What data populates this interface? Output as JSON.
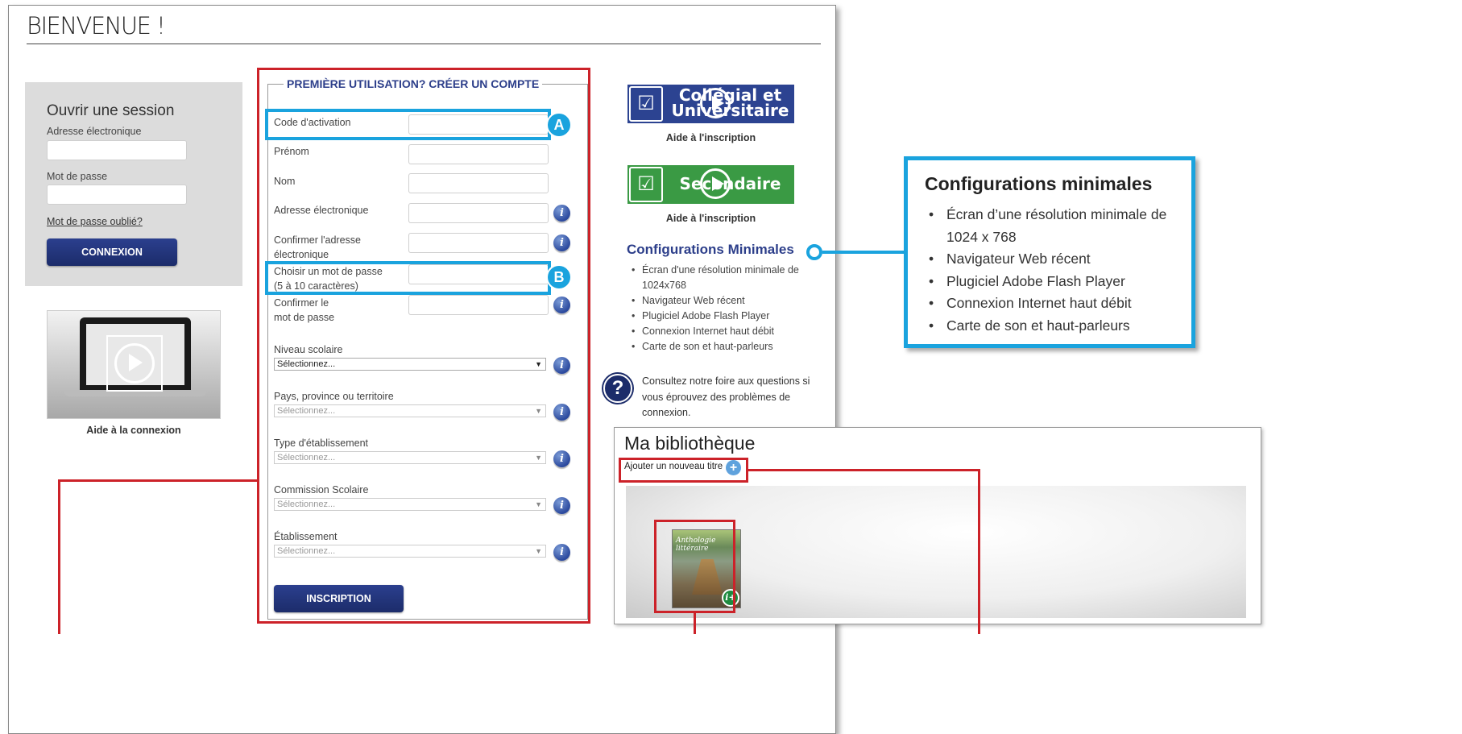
{
  "page": {
    "title": "BIENVENUE !"
  },
  "login": {
    "title": "Ouvrir une session",
    "email_label": "Adresse électronique",
    "email_value": "",
    "password_label": "Mot de passe",
    "password_value": "",
    "forgot_link": "Mot de passe oublié?",
    "submit_label": "CONNEXION",
    "video_caption": "Aide à la connexion",
    "video_icon": "play-icon"
  },
  "registration": {
    "legend": "PREMIÈRE UTILISATION? CRÉER UN COMPTE",
    "fields": {
      "activation_code": {
        "label": "Code d'activation",
        "value": ""
      },
      "first_name": {
        "label": "Prénom",
        "value": ""
      },
      "last_name": {
        "label": "Nom",
        "value": ""
      },
      "email": {
        "label": "Adresse électronique",
        "value": ""
      },
      "email_confirm": {
        "label_line1": "Confirmer l'adresse",
        "label_line2": "électronique",
        "value": ""
      },
      "password": {
        "label_line1": "Choisir un mot de passe",
        "label_line2": "(5 à 10 caractères)",
        "value": ""
      },
      "password_confirm": {
        "label_line1": "Confirmer le",
        "label_line2": "mot de passe",
        "value": ""
      }
    },
    "selects": {
      "level": {
        "label": "Niveau scolaire",
        "selected": "Sélectionnez..."
      },
      "region": {
        "label": "Pays, province ou territoire",
        "selected": "Sélectionnez..."
      },
      "institution_type": {
        "label": "Type d'établissement",
        "selected": "Sélectionnez..."
      },
      "school_board": {
        "label": "Commission Scolaire",
        "selected": "Sélectionnez..."
      },
      "institution": {
        "label": "Établissement",
        "selected": "Sélectionnez..."
      }
    },
    "submit_label": "INSCRIPTION",
    "info_icon_glyph": "i",
    "select_arrow": "▼"
  },
  "annotations": {
    "badge_a": "A",
    "badge_b": "B"
  },
  "help": {
    "college": {
      "banner_line1": "Collégial et",
      "banner_line2": "Universitaire",
      "caption": "Aide à l'inscription",
      "color": "#2c4391"
    },
    "secondary": {
      "banner_text": "Secondaire",
      "caption": "Aide à l'inscription",
      "color": "#3a9a44"
    }
  },
  "config": {
    "title": "Configurations Minimales",
    "items": [
      "Écran d'une résolution minimale de 1024x768",
      "Navigateur Web récent",
      "Plugiciel Adobe Flash Player",
      "Connexion Internet haut débit",
      "Carte de son et haut-parleurs"
    ]
  },
  "faq": {
    "icon_glyph": "?",
    "text": "Consultez notre foire aux questions si vous éprouvez des problèmes de connexion."
  },
  "callout": {
    "title": "Configurations minimales",
    "items": [
      "Écran d’une résolution minimale de 1024 x 768",
      "Navigateur Web récent",
      "Plugiciel Adobe Flash Player",
      "Connexion Internet haut débit",
      "Carte de son et haut-parleurs"
    ]
  },
  "library": {
    "title": "Ma bibliothèque",
    "add_label": "Ajouter un nouveau titre",
    "add_icon_glyph": "+",
    "book_title_line1": "Anthologie littéraire",
    "book_info_glyph": "i+"
  },
  "colors": {
    "accent_blue": "#1aa3de",
    "annotation_red": "#cc2229",
    "brand_navy": "#1c2c6a"
  }
}
